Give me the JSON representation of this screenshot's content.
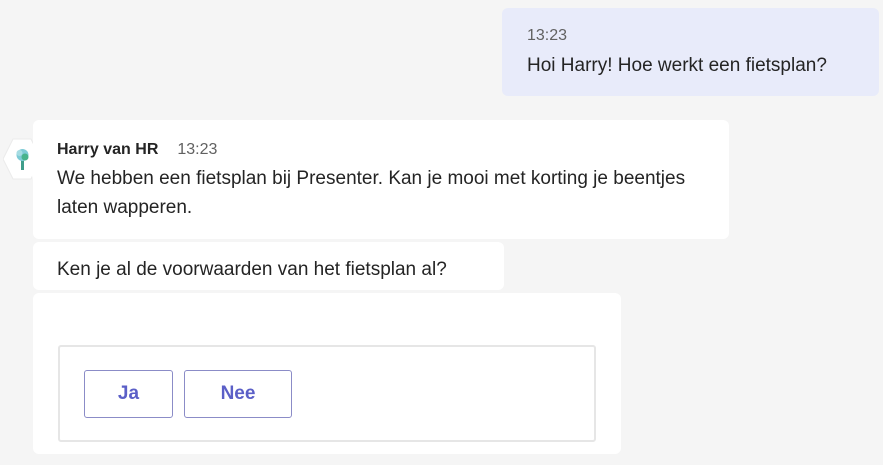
{
  "own_message": {
    "time": "13:23",
    "text": "Hoi Harry! Hoe werkt een fietsplan?"
  },
  "bot": {
    "name": "Harry van HR",
    "time": "13:23",
    "avatar_icon": "bot-tree-icon",
    "status_icon": "available-check-icon",
    "status_color": "#6bb700"
  },
  "messages": [
    {
      "text": "We hebben een fietsplan bij Presenter. Kan je mooi met korting je beentjes laten wapperen."
    },
    {
      "text": "Ken je al de voorwaarden van het fietsplan al?"
    }
  ],
  "card": {
    "buttons": [
      {
        "label": "Ja"
      },
      {
        "label": "Nee"
      }
    ]
  },
  "colors": {
    "background": "#f5f5f5",
    "own_bubble": "#e8ebfa",
    "bubble": "#ffffff",
    "accent": "#5b5fc7"
  }
}
